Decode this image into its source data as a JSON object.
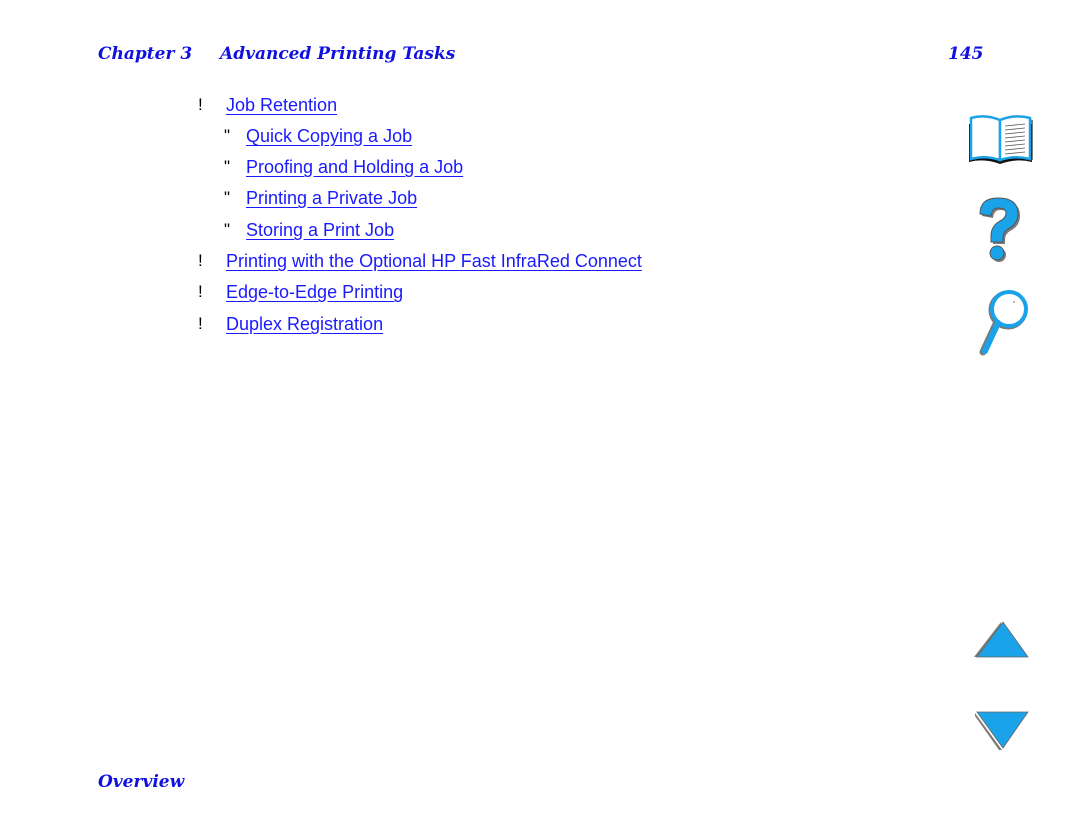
{
  "header": {
    "chapter": "Chapter 3",
    "title": "Advanced Printing Tasks",
    "page_number": "145"
  },
  "toc": {
    "items": [
      {
        "bullet": "!",
        "label": "Job Retention",
        "level": 1
      },
      {
        "bullet": "\"",
        "label": "Quick Copying a Job",
        "level": 2
      },
      {
        "bullet": "\"",
        "label": "Proofing and Holding a Job",
        "level": 2
      },
      {
        "bullet": "\"",
        "label": "Printing a Private Job",
        "level": 2
      },
      {
        "bullet": "\"",
        "label": "Storing a Print Job",
        "level": 2
      },
      {
        "bullet": "!",
        "label": "Printing with the Optional HP Fast InfraRed Connect",
        "level": 1
      },
      {
        "bullet": "!",
        "label": "Edge-to-Edge Printing",
        "level": 1
      },
      {
        "bullet": "!",
        "label": "Duplex Registration",
        "level": 1
      }
    ]
  },
  "footer": {
    "section": "Overview"
  },
  "sidebar_icons": [
    {
      "name": "book-icon",
      "meaning": "contents"
    },
    {
      "name": "question-mark-icon",
      "meaning": "help"
    },
    {
      "name": "magnifier-icon",
      "meaning": "search"
    },
    {
      "name": "arrow-up-icon",
      "meaning": "previous page"
    },
    {
      "name": "arrow-down-icon",
      "meaning": "next page"
    }
  ],
  "colors": {
    "heading": "#1010e0",
    "link": "#1a1aff",
    "icon_fill": "#1aa3e8",
    "icon_shadow": "#7a7a7a"
  }
}
